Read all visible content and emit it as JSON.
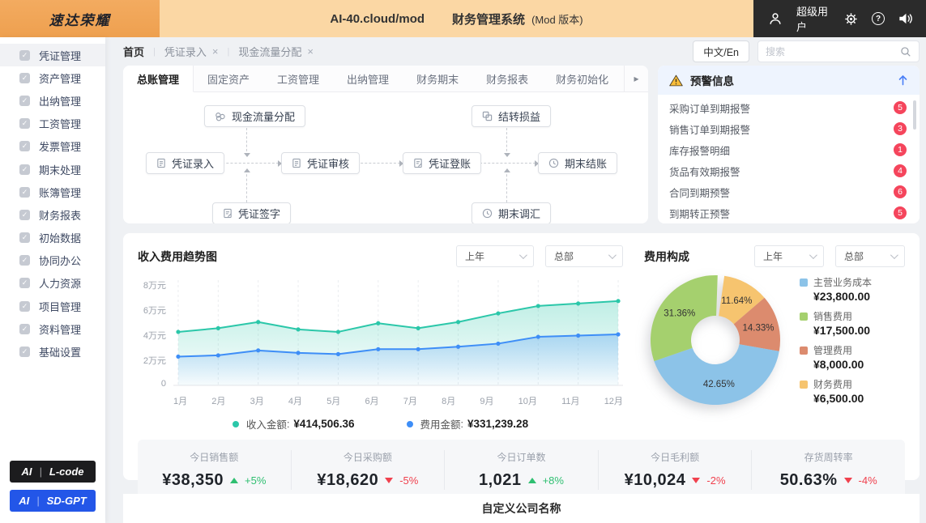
{
  "topbar": {
    "logo": "速达荣耀",
    "domain": "AI-40.cloud/mod",
    "system": "财务管理系统",
    "version": "(Mod 版本)",
    "user": "超级用户"
  },
  "sidebar": {
    "items": [
      "凭证管理",
      "资产管理",
      "出纳管理",
      "工资管理",
      "发票管理",
      "期末处理",
      "账簿管理",
      "财务报表",
      "初始数据",
      "协同办公",
      "人力资源",
      "项目管理",
      "资料管理",
      "基础设置"
    ],
    "active_index": 0,
    "badges": [
      {
        "prefix": "AI",
        "divider": "|",
        "label": "L-code",
        "bg": "#1c1c1e"
      },
      {
        "prefix": "AI",
        "divider": "|",
        "label": "SD-GPT",
        "bg": "#2356e8"
      }
    ]
  },
  "breadcrumb": {
    "home": "首页",
    "separator": "|",
    "close_icon": "×",
    "tabs": [
      "凭证录入",
      "现金流量分配"
    ]
  },
  "toolbar": {
    "lang_button": "中文/En",
    "search_placeholder": "搜索"
  },
  "module_tabs": {
    "items": [
      "总账管理",
      "固定资产",
      "工资管理",
      "出纳管理",
      "财务期末",
      "财务报表",
      "财务初始化"
    ],
    "active_index": 0,
    "scroll_arrow": "▸"
  },
  "flow": {
    "nodes": {
      "cashflow": "现金流量分配",
      "carryover": "结转损益",
      "entry": "凭证录入",
      "review": "凭证审核",
      "posting": "凭证登账",
      "closing": "期末结账",
      "signing": "凭证签字",
      "revaluation": "期末调汇"
    }
  },
  "alerts": {
    "title": "预警信息",
    "items": [
      {
        "label": "采购订单到期报警",
        "count": "5"
      },
      {
        "label": "销售订单到期报警",
        "count": "3"
      },
      {
        "label": "库存报警明细",
        "count": "1"
      },
      {
        "label": "货品有效期报警",
        "count": "4"
      },
      {
        "label": "合同到期预警",
        "count": "6"
      },
      {
        "label": "到期转正预警",
        "count": "5"
      }
    ],
    "badge_color": "#f5455c"
  },
  "stats": {
    "items": [
      {
        "label": "今日销售额",
        "value": "¥38,350",
        "change": "+5%",
        "direction": "up"
      },
      {
        "label": "今日采购额",
        "value": "¥18,620",
        "change": "-5%",
        "direction": "down"
      },
      {
        "label": "今日订单数",
        "value": "1,021",
        "change": "+8%",
        "direction": "up"
      },
      {
        "label": "今日毛利额",
        "value": "¥10,024",
        "change": "-2%",
        "direction": "down"
      },
      {
        "label": "存货周转率",
        "value": "50.63%",
        "change": "-4%",
        "direction": "down"
      }
    ]
  },
  "footer": {
    "company": "自定义公司名称"
  },
  "colors": {
    "logo_orange": "#f0a455",
    "topbar_peach": "#fbd7a4",
    "topbar_dark": "#2b2b2b",
    "alert_badge_red": "#f5455c",
    "link_blue": "#4a7ff7",
    "up_green": "#2fbf71",
    "down_red": "#f0414e",
    "sdgpt_blue": "#2356e8"
  },
  "chart_data": [
    {
      "type": "line",
      "title": "收入费用趋势图",
      "filters": [
        "上年",
        "总部"
      ],
      "legend_separator": ":",
      "x": [
        "1月",
        "2月",
        "3月",
        "4月",
        "5月",
        "6月",
        "7月",
        "8月",
        "9月",
        "10月",
        "11月",
        "12月"
      ],
      "yticks": [
        "8万元",
        "6万元",
        "4万元",
        "2万元",
        "0"
      ],
      "ylim": [
        0,
        8
      ],
      "y_unit": "万元",
      "grid": "vertical-dashed",
      "legend_position": "bottom",
      "series": [
        {
          "name": "收入金额",
          "total": "¥414,506.36",
          "color": "#2bc7a9",
          "values": [
            4.2,
            4.5,
            5.0,
            4.4,
            4.2,
            4.9,
            4.5,
            5.0,
            5.7,
            6.3,
            6.5,
            6.7
          ]
        },
        {
          "name": "费用金额",
          "total": "¥331,239.28",
          "color": "#3e8ef7",
          "values": [
            2.2,
            2.3,
            2.7,
            2.5,
            2.4,
            2.8,
            2.8,
            3.0,
            3.25,
            3.8,
            3.9,
            4.0
          ]
        }
      ]
    },
    {
      "type": "pie",
      "title": "费用构成",
      "filters": [
        "上年",
        "总部"
      ],
      "donut": true,
      "legend_position": "right",
      "slices": [
        {
          "label": "主营业务成本",
          "value": 23800,
          "amount": "¥23,800.00",
          "percent": "42.65%",
          "color": "#8cc3e8"
        },
        {
          "label": "销售费用",
          "value": 17500,
          "amount": "¥17,500.00",
          "percent": "31.36%",
          "color": "#a5d06e"
        },
        {
          "label": "管理费用",
          "value": 8000,
          "amount": "¥8,000.00",
          "percent": "14.33%",
          "color": "#dc8b6e"
        },
        {
          "label": "财务费用",
          "value": 6500,
          "amount": "¥6,500.00",
          "percent": "11.64%",
          "color": "#f6c46f"
        }
      ]
    }
  ]
}
